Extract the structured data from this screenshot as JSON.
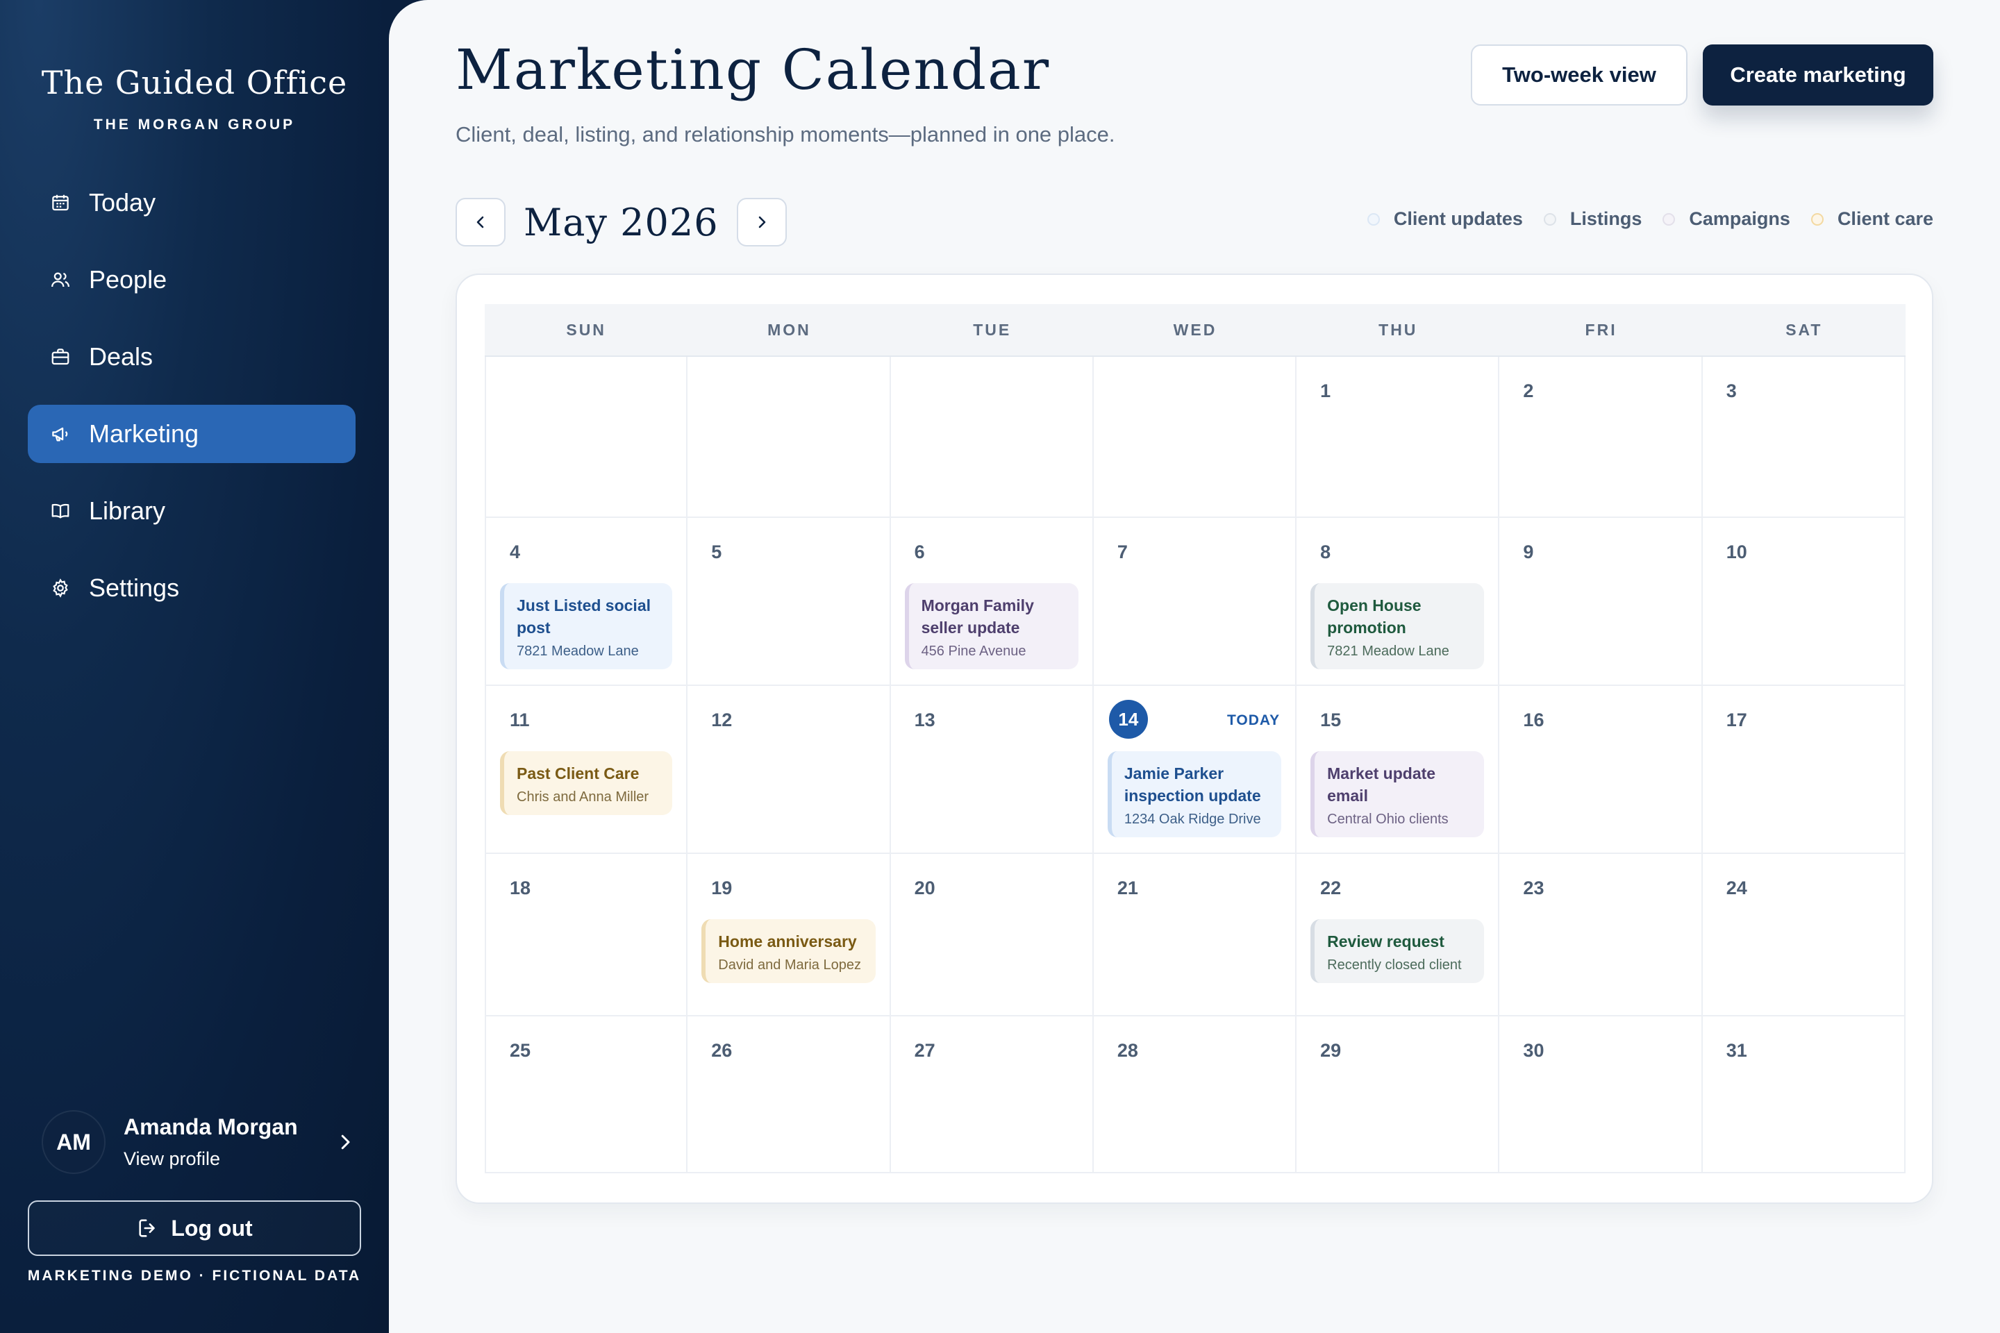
{
  "sidebar": {
    "brand_title": "The Guided Office",
    "brand_subtitle": "THE MORGAN GROUP",
    "nav": [
      {
        "label": "Today",
        "icon": "calendar-icon"
      },
      {
        "label": "People",
        "icon": "people-icon"
      },
      {
        "label": "Deals",
        "icon": "briefcase-icon"
      },
      {
        "label": "Marketing",
        "icon": "megaphone-icon",
        "active": true
      },
      {
        "label": "Library",
        "icon": "book-icon"
      },
      {
        "label": "Settings",
        "icon": "gear-icon"
      }
    ],
    "profile": {
      "initials": "AM",
      "name": "Amanda Morgan",
      "link": "View profile"
    },
    "logout_label": "Log out",
    "footer_note": "MARKETING DEMO · FICTIONAL DATA"
  },
  "header": {
    "title": "Marketing Calendar",
    "subtitle": "Client, deal, listing, and relationship moments—planned in one place.",
    "two_week_label": "Two-week view",
    "create_label": "Create marketing"
  },
  "calendar": {
    "month_label": "May 2026",
    "legend": [
      {
        "label": "Client updates",
        "color": "#dbe7f5"
      },
      {
        "label": "Listings",
        "color": "#dde2e8"
      },
      {
        "label": "Campaigns",
        "color": "#e3e0ea"
      },
      {
        "label": "Client care",
        "color": "#f3d9a1"
      }
    ],
    "weekdays": [
      "SUN",
      "MON",
      "TUE",
      "WED",
      "THU",
      "FRI",
      "SAT"
    ],
    "today_label": "TODAY",
    "weeks": [
      [
        {
          "day": ""
        },
        {
          "day": ""
        },
        {
          "day": ""
        },
        {
          "day": ""
        },
        {
          "day": "1"
        },
        {
          "day": "2"
        },
        {
          "day": "3"
        }
      ],
      [
        {
          "day": "4",
          "event": {
            "title": "Just Listed social post",
            "sub": "7821 Meadow Lane",
            "kind": "blue"
          }
        },
        {
          "day": "5"
        },
        {
          "day": "6",
          "event": {
            "title": "Morgan Family seller update",
            "sub": "456 Pine Avenue",
            "kind": "purple"
          }
        },
        {
          "day": "7"
        },
        {
          "day": "8",
          "event": {
            "title": "Open House promotion",
            "sub": "7821 Meadow Lane",
            "kind": "gray"
          }
        },
        {
          "day": "9"
        },
        {
          "day": "10"
        }
      ],
      [
        {
          "day": "11",
          "event": {
            "title": "Past Client Care",
            "sub": "Chris and Anna Miller",
            "kind": "gold"
          }
        },
        {
          "day": "12"
        },
        {
          "day": "13"
        },
        {
          "day": "14",
          "today": true,
          "event": {
            "title": "Jamie Parker inspection update",
            "sub": "1234 Oak Ridge Drive",
            "kind": "blue"
          }
        },
        {
          "day": "15",
          "event": {
            "title": "Market update email",
            "sub": "Central Ohio clients",
            "kind": "purple"
          }
        },
        {
          "day": "16"
        },
        {
          "day": "17"
        }
      ],
      [
        {
          "day": "18"
        },
        {
          "day": "19",
          "event": {
            "title": "Home anniversary",
            "sub": "David and Maria Lopez",
            "kind": "gold"
          }
        },
        {
          "day": "20"
        },
        {
          "day": "21"
        },
        {
          "day": "22",
          "event": {
            "title": "Review request",
            "sub": "Recently closed client",
            "kind": "gray"
          }
        },
        {
          "day": "23"
        },
        {
          "day": "24"
        }
      ],
      [
        {
          "day": "25"
        },
        {
          "day": "26"
        },
        {
          "day": "27"
        },
        {
          "day": "28"
        },
        {
          "day": "29"
        },
        {
          "day": "30"
        },
        {
          "day": "31"
        }
      ]
    ]
  }
}
